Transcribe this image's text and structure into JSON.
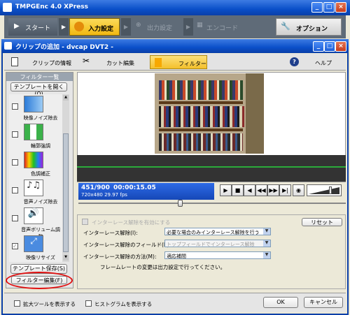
{
  "app": {
    "title": "TMPGEnc 4.0 XPress",
    "buttons": {
      "minimize": "_",
      "maximize": "□",
      "close": "×"
    }
  },
  "main_toolbar": {
    "start": "スタート",
    "input_settings": "入力設定",
    "output_settings": "出力設定",
    "encode": "エンコード",
    "options": "オプション"
  },
  "dialog": {
    "title": "クリップの追加 - dvcap DVT2 -",
    "tabs": [
      {
        "label": "クリップの情報"
      },
      {
        "label": "カット編集"
      },
      {
        "label": "フィルター"
      },
      {
        "label": "ヘルプ"
      }
    ]
  },
  "filter_panel": {
    "header": "フィルター一覧",
    "template_open": "テンプレートを開く(O)",
    "items": [
      {
        "label": "映像ノイズ除去",
        "checked": false
      },
      {
        "label": "輪郭強調",
        "checked": false
      },
      {
        "label": "色調補正",
        "checked": false
      },
      {
        "label": "音声ノイズ除去",
        "checked": false
      },
      {
        "label": "音声ボリューム調整",
        "checked": false
      },
      {
        "label": "映像リサイズ",
        "checked": true
      }
    ],
    "template_save": "テンプレート保存(S)",
    "filter_edit": "フィルター編集(F)"
  },
  "playback": {
    "frame": "451/900",
    "timecode": "00:00:15.05",
    "info": "720x480 29.97 fps",
    "slider_level": 0.38,
    "volume_level": 0.7
  },
  "settings": {
    "deinterlace_check_label": "インターレース解除を有効にする",
    "reset": "リセット",
    "rows": [
      {
        "label": "インターレース解除(I):",
        "value": "必要な場合のみインターレース解除を行う"
      },
      {
        "label": "インターレース解除のフィールド(F):",
        "value": "トップフィールドでインターレース解除"
      },
      {
        "label": "インターレース解除の方法(M):",
        "value": "適応補間"
      }
    ],
    "note": "フレームレートの変更は出力設定で行ってください。"
  },
  "bottom": {
    "expand_tool": "拡大ツールを表示する",
    "histogram": "ヒストグラムを表示する",
    "ok": "OK",
    "cancel": "キャンセル"
  },
  "colors": {
    "titlebar": "#0A4FC9",
    "toolbar": "#5F6B78",
    "active_tab": "#F4C02B",
    "highlight_circle": "#E01010"
  }
}
